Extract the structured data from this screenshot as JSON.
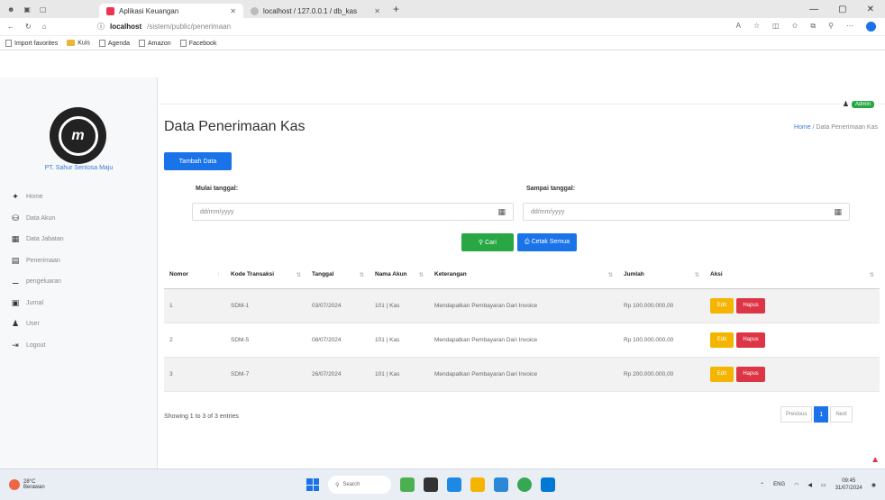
{
  "browser": {
    "tabs": [
      {
        "label": "Aplikasi Keuangan",
        "active": true
      },
      {
        "label": "localhost / 127.0.0.1 / db_kas",
        "active": false
      }
    ],
    "url_host": "localhost",
    "url_path": "/sistem/public/penerimaan",
    "bookmarks": [
      "Import favorites",
      "Kuis",
      "Agenda",
      "Amazon",
      "Facebook"
    ]
  },
  "sidebar": {
    "company": "PT. Sahur Sentosa Maju",
    "items": [
      {
        "label": "Home",
        "icon": "home-icon"
      },
      {
        "label": "Data Akun",
        "icon": "database-icon"
      },
      {
        "label": "Data Jabatan",
        "icon": "building-icon"
      },
      {
        "label": "Penerimaan",
        "icon": "clipboard-icon"
      },
      {
        "label": "pengeluaran",
        "icon": "user-minus-icon"
      },
      {
        "label": "Jurnal",
        "icon": "book-icon"
      },
      {
        "label": "User",
        "icon": "user-icon"
      },
      {
        "label": "Logout",
        "icon": "logout-icon"
      }
    ]
  },
  "header": {
    "user_badge": "Admin"
  },
  "page": {
    "title": "Data Penerimaan Kas",
    "breadcrumb_home": "Home",
    "breadcrumb_current": "Data Penerimaan Kas",
    "add_button": "Tambah Data"
  },
  "filter": {
    "start_label": "Mulai tanggal:",
    "end_label": "Sampai tanggal:",
    "start_placeholder": "dd/mm/yyyy",
    "end_placeholder": "dd/mm/yyyy",
    "search_button": "Cari",
    "print_button": "Cetak Semua"
  },
  "table": {
    "columns": [
      "Nomor",
      "Kode Transaksi",
      "Tanggal",
      "Nama Akun",
      "Keterangan",
      "Jumlah",
      "Aksi"
    ],
    "rows": [
      {
        "no": "1",
        "kode": "SDM-1",
        "tanggal": "03/07/2024",
        "akun": "101 | Kas",
        "ket": "Mendapatkan Pembayaran Dari Invoice",
        "jumlah": "Rp 100.000.000,00"
      },
      {
        "no": "2",
        "kode": "SDM-5",
        "tanggal": "08/07/2024",
        "akun": "101 | Kas",
        "ket": "Mendapatkan Pembayaran Dari Invoice",
        "jumlah": "Rp 100.000.000,00"
      },
      {
        "no": "3",
        "kode": "SDM-7",
        "tanggal": "26/07/2024",
        "akun": "101 | Kas",
        "ket": "Mendapatkan Pembayaran Dari Invoice",
        "jumlah": "Rp 200.000.000,00"
      }
    ],
    "edit_label": "Edit",
    "delete_label": "Hapus",
    "info": "Showing 1 to 3 of 3 entries",
    "prev": "Previous",
    "page": "1",
    "next": "Next"
  },
  "taskbar": {
    "weather_temp": "28°C",
    "weather_desc": "Berawan",
    "search": "Search",
    "time": "09:45",
    "date": "31/07/2024"
  }
}
